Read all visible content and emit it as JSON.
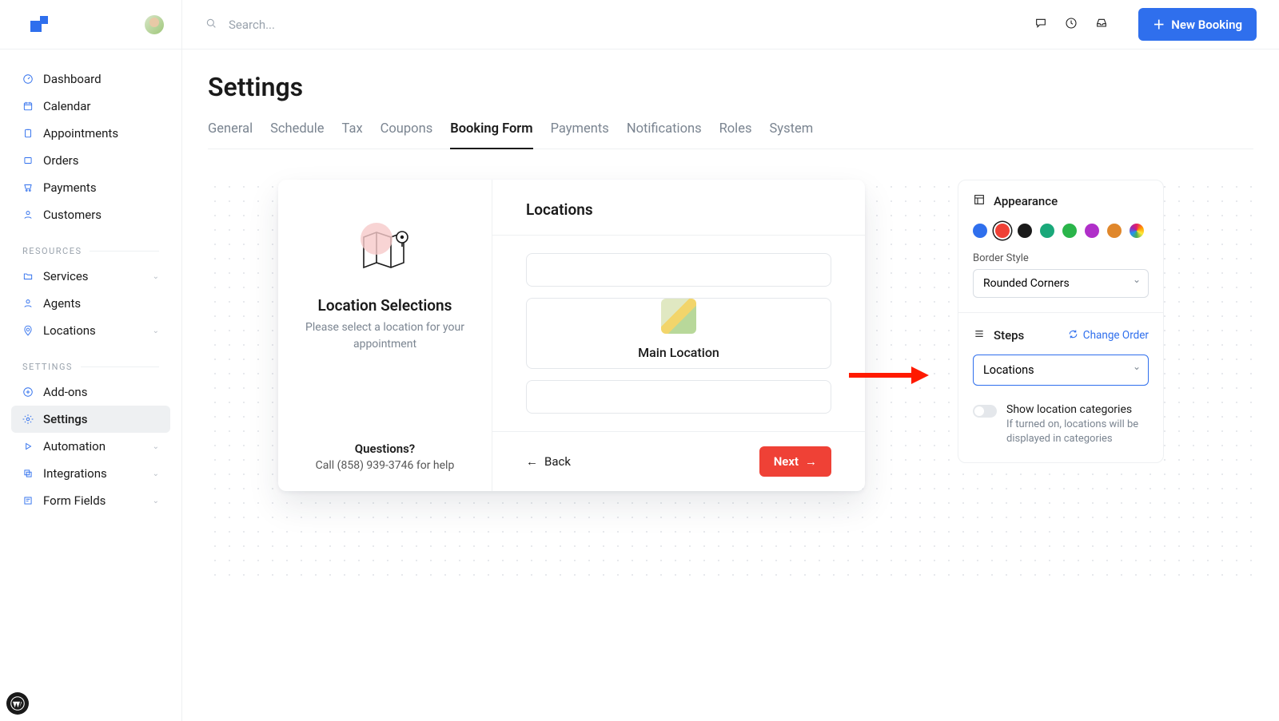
{
  "header": {
    "search_placeholder": "Search...",
    "new_booking_label": "New Booking"
  },
  "sidebar": {
    "items": [
      {
        "label": "Dashboard",
        "icon": "gauge"
      },
      {
        "label": "Calendar",
        "icon": "calendar"
      },
      {
        "label": "Appointments",
        "icon": "clipboard"
      },
      {
        "label": "Orders",
        "icon": "box"
      },
      {
        "label": "Payments",
        "icon": "cart"
      },
      {
        "label": "Customers",
        "icon": "user"
      }
    ],
    "resources_label": "RESOURCES",
    "resources": [
      {
        "label": "Services",
        "icon": "folder",
        "caret": true
      },
      {
        "label": "Agents",
        "icon": "user",
        "caret": false
      },
      {
        "label": "Locations",
        "icon": "pin",
        "caret": true
      }
    ],
    "settings_label": "SETTINGS",
    "settings": [
      {
        "label": "Add-ons",
        "icon": "plus-circle",
        "caret": false
      },
      {
        "label": "Settings",
        "icon": "gear",
        "caret": false,
        "active": true
      },
      {
        "label": "Automation",
        "icon": "play",
        "caret": true
      },
      {
        "label": "Integrations",
        "icon": "copy",
        "caret": true
      },
      {
        "label": "Form Fields",
        "icon": "form",
        "caret": true
      }
    ]
  },
  "page": {
    "title": "Settings",
    "tabs": [
      "General",
      "Schedule",
      "Tax",
      "Coupons",
      "Booking Form",
      "Payments",
      "Notifications",
      "Roles",
      "System"
    ],
    "active_tab": "Booking Form"
  },
  "preview": {
    "left_title": "Location Selections",
    "left_sub": "Please select a location for your appointment",
    "questions_title": "Questions?",
    "questions_sub": "Call (858) 939-3746 for help",
    "right_title": "Locations",
    "main_location_label": "Main Location",
    "back_label": "Back",
    "next_label": "Next"
  },
  "panel": {
    "appearance_label": "Appearance",
    "colors": [
      {
        "hex": "#2f6fed",
        "name": "blue"
      },
      {
        "hex": "#ef4136",
        "name": "red",
        "selected": true
      },
      {
        "hex": "#1a1a1a",
        "name": "black"
      },
      {
        "hex": "#1aa87a",
        "name": "teal"
      },
      {
        "hex": "#2ab54a",
        "name": "green"
      },
      {
        "hex": "#b02fc9",
        "name": "purple"
      },
      {
        "hex": "#e0872b",
        "name": "orange"
      },
      {
        "hex": "rainbow",
        "name": "custom"
      }
    ],
    "border_style_label": "Border Style",
    "border_style_value": "Rounded Corners",
    "steps_label": "Steps",
    "change_order_label": "Change Order",
    "step_select_value": "Locations",
    "toggle_title": "Show location categories",
    "toggle_sub": "If turned on, locations will be displayed in categories"
  }
}
